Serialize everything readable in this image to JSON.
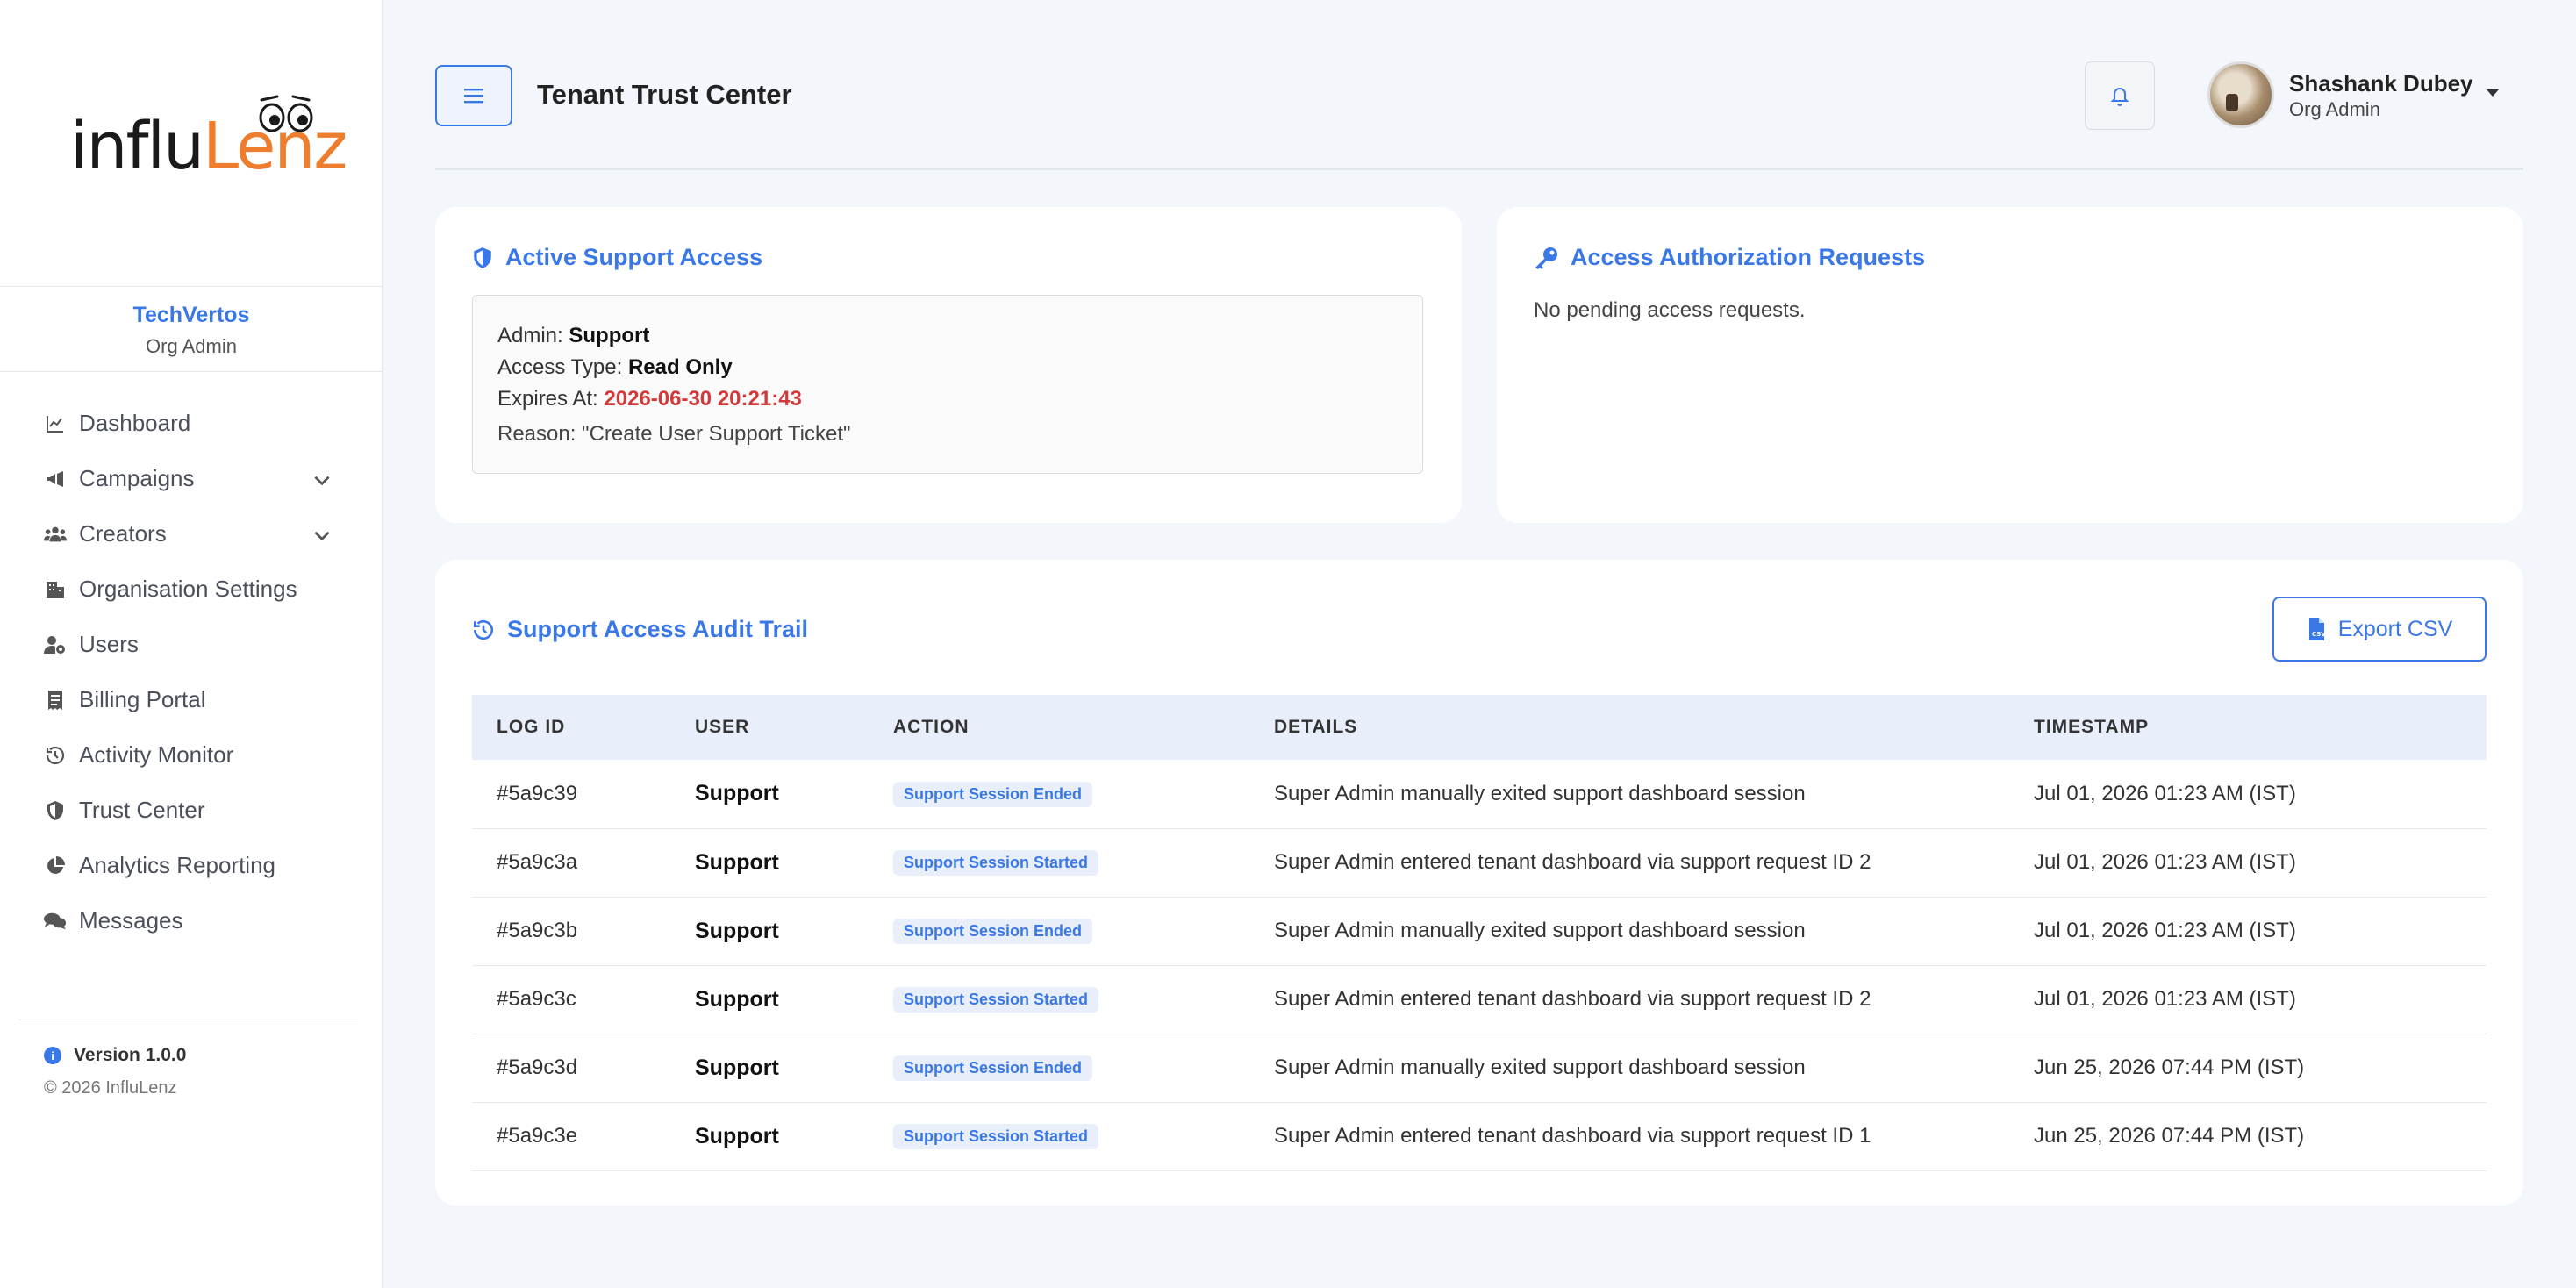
{
  "brand": {
    "logo_part1": "influ",
    "logo_part2": "Lenz",
    "org_name": "TechVertos",
    "org_role": "Org Admin"
  },
  "sidebar": {
    "items": [
      {
        "label": "Dashboard",
        "icon": "chart-line-icon"
      },
      {
        "label": "Campaigns",
        "icon": "megaphone-icon"
      },
      {
        "label": "Creators",
        "icon": "users-icon"
      },
      {
        "label": "Organisation Settings",
        "icon": "building-icon"
      },
      {
        "label": "Users",
        "icon": "user-gear-icon"
      },
      {
        "label": "Billing Portal",
        "icon": "receipt-icon"
      },
      {
        "label": "Activity Monitor",
        "icon": "history-icon"
      },
      {
        "label": "Trust Center",
        "icon": "shield-icon"
      },
      {
        "label": "Analytics Reporting",
        "icon": "pie-chart-icon"
      },
      {
        "label": "Messages",
        "icon": "comments-icon"
      }
    ],
    "version": "Version 1.0.0",
    "copyright": "© 2026 InfluLenz"
  },
  "header": {
    "title": "Tenant Trust Center",
    "user_name": "Shashank Dubey",
    "user_role": "Org Admin"
  },
  "active_access": {
    "title": "Active Support Access",
    "admin_label": "Admin:",
    "admin_value": "Support",
    "type_label": "Access Type:",
    "type_value": "Read Only",
    "expires_label": "Expires At:",
    "expires_value": "2026-06-30 20:21:43",
    "reason": "Reason: \"Create User Support Ticket\""
  },
  "requests": {
    "title": "Access Authorization Requests",
    "empty_text": "No pending access requests."
  },
  "audit": {
    "title": "Support Access Audit Trail",
    "export_label": "Export CSV",
    "columns": [
      "LOG ID",
      "USER",
      "ACTION",
      "DETAILS",
      "TIMESTAMP"
    ],
    "rows": [
      {
        "id": "#5a9c39",
        "user": "Support",
        "action": "Support Session Ended",
        "details": "Super Admin manually exited support dashboard session",
        "timestamp": "Jul 01, 2026 01:23 AM (IST)"
      },
      {
        "id": "#5a9c3a",
        "user": "Support",
        "action": "Support Session Started",
        "details": "Super Admin entered tenant dashboard via support request ID 2",
        "timestamp": "Jul 01, 2026 01:23 AM (IST)"
      },
      {
        "id": "#5a9c3b",
        "user": "Support",
        "action": "Support Session Ended",
        "details": "Super Admin manually exited support dashboard session",
        "timestamp": "Jul 01, 2026 01:23 AM (IST)"
      },
      {
        "id": "#5a9c3c",
        "user": "Support",
        "action": "Support Session Started",
        "details": "Super Admin entered tenant dashboard via support request ID 2",
        "timestamp": "Jul 01, 2026 01:23 AM (IST)"
      },
      {
        "id": "#5a9c3d",
        "user": "Support",
        "action": "Support Session Ended",
        "details": "Super Admin manually exited support dashboard session",
        "timestamp": "Jun 25, 2026 07:44 PM (IST)"
      },
      {
        "id": "#5a9c3e",
        "user": "Support",
        "action": "Support Session Started",
        "details": "Super Admin entered tenant dashboard via support request ID 1",
        "timestamp": "Jun 25, 2026 07:44 PM (IST)"
      }
    ]
  },
  "colors": {
    "accent": "#3b78e7",
    "brand_orange": "#ef7d2e",
    "expiry_red": "#d23a3a",
    "background": "#f3f6fb"
  }
}
